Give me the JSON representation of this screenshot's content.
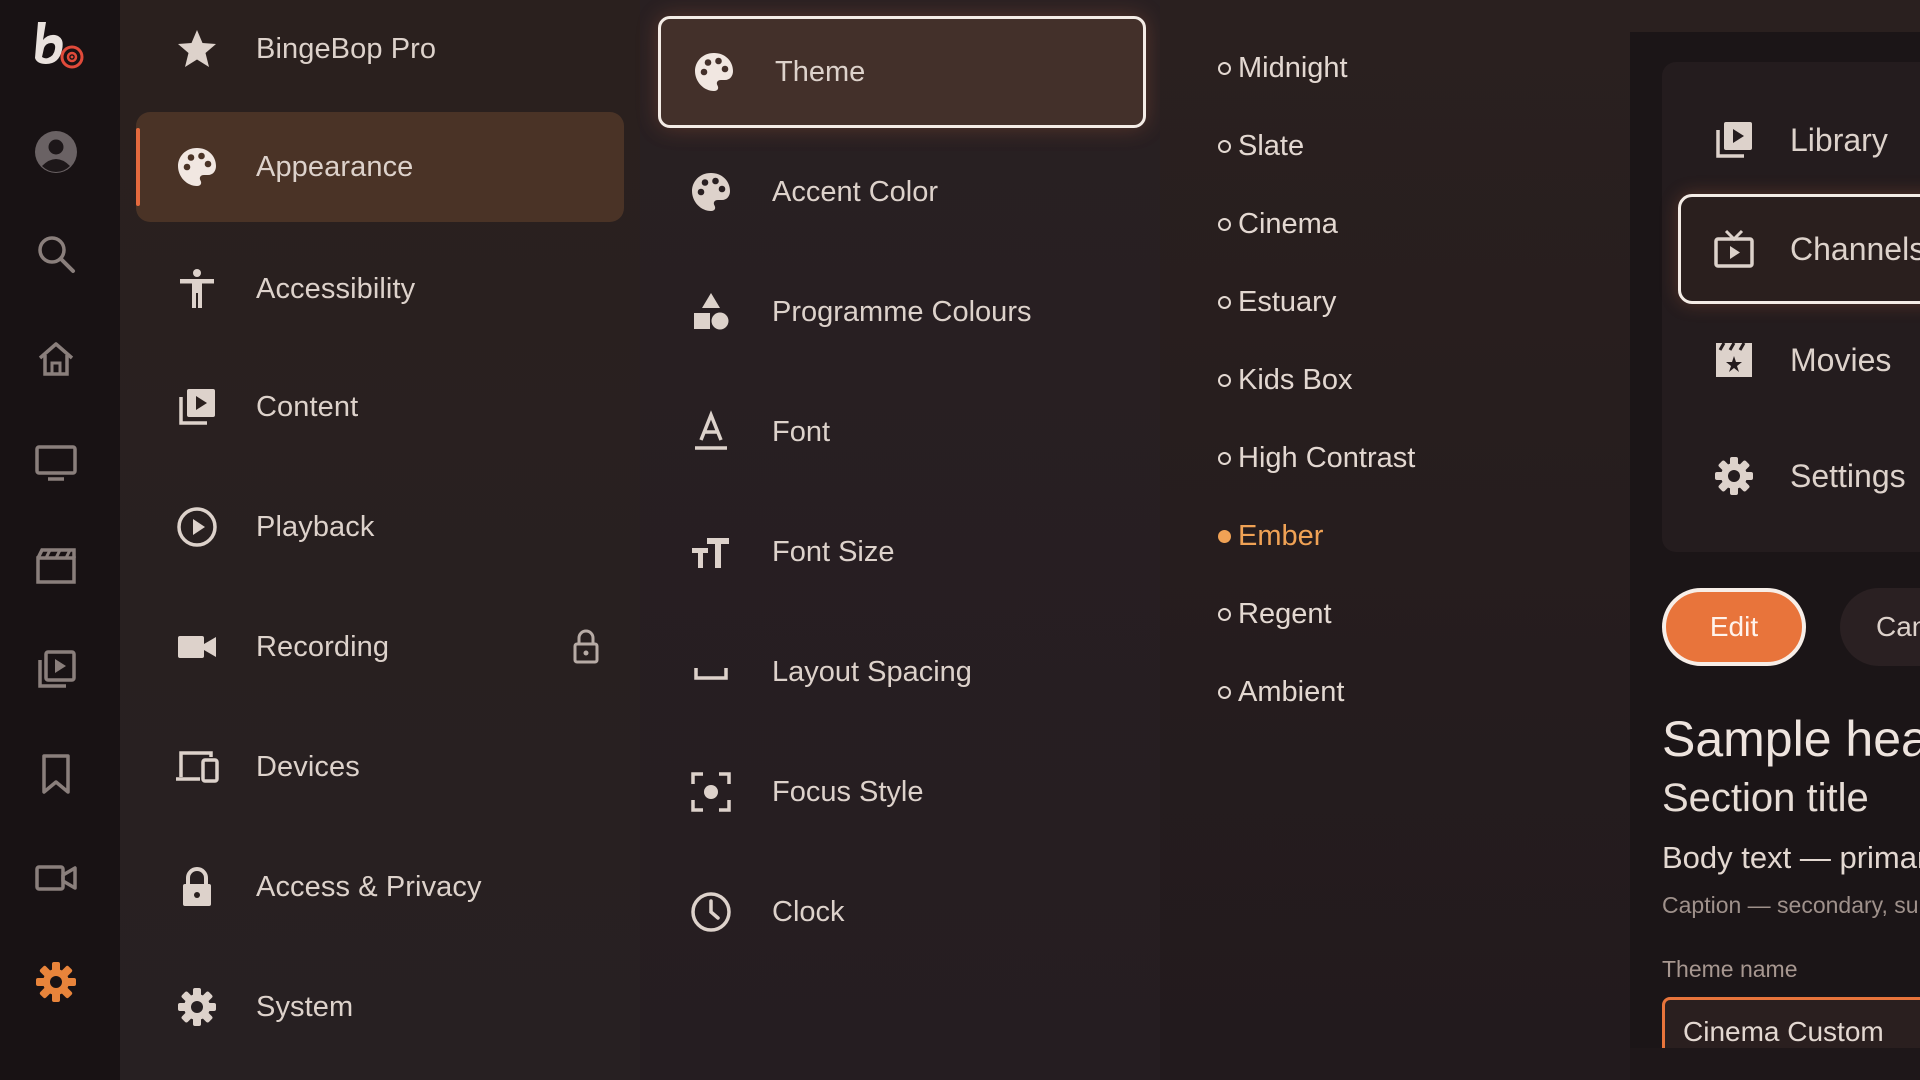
{
  "rail": {
    "items": [
      {
        "icon": "profile-icon"
      },
      {
        "icon": "search-icon"
      },
      {
        "icon": "home-icon"
      },
      {
        "icon": "tv-icon"
      },
      {
        "icon": "movies-icon"
      },
      {
        "icon": "library-icon"
      },
      {
        "icon": "bookmark-icon"
      },
      {
        "icon": "recordings-icon"
      },
      {
        "icon": "settings-icon",
        "active": true
      }
    ],
    "accent": "#e8843b"
  },
  "settings_menu": {
    "items": [
      {
        "label": "BingeBop Pro",
        "icon": "star-icon"
      },
      {
        "label": "Appearance",
        "icon": "palette-icon",
        "active": true
      },
      {
        "label": "Accessibility",
        "icon": "accessibility-icon"
      },
      {
        "label": "Content",
        "icon": "content-library-icon"
      },
      {
        "label": "Playback",
        "icon": "play-circle-icon"
      },
      {
        "label": "Recording",
        "icon": "camera-icon",
        "locked": true
      },
      {
        "label": "Devices",
        "icon": "devices-icon"
      },
      {
        "label": "Access & Privacy",
        "icon": "lock-icon"
      },
      {
        "label": "System",
        "icon": "gear-icon"
      }
    ]
  },
  "appearance_menu": {
    "items": [
      {
        "label": "Theme",
        "icon": "palette-icon",
        "focused": true
      },
      {
        "label": "Accent Color",
        "icon": "palette-icon"
      },
      {
        "label": "Programme Colours",
        "icon": "shapes-icon"
      },
      {
        "label": "Font",
        "icon": "font-icon"
      },
      {
        "label": "Font Size",
        "icon": "font-size-icon"
      },
      {
        "label": "Layout Spacing",
        "icon": "spacing-icon"
      },
      {
        "label": "Focus Style",
        "icon": "focus-icon"
      },
      {
        "label": "Clock",
        "icon": "clock-icon"
      }
    ]
  },
  "theme_options": {
    "items": [
      {
        "label": "Midnight"
      },
      {
        "label": "Slate"
      },
      {
        "label": "Cinema"
      },
      {
        "label": "Estuary"
      },
      {
        "label": "Kids Box"
      },
      {
        "label": "High Contrast"
      },
      {
        "label": "Ember",
        "selected": true
      },
      {
        "label": "Regent"
      },
      {
        "label": "Ambient"
      }
    ],
    "selected_color": "#f0a255"
  },
  "preview": {
    "nav": [
      {
        "label": "Library",
        "icon": "library-icon"
      },
      {
        "label": "Channels",
        "icon": "tv-play-icon",
        "focused": true
      },
      {
        "label": "Movies",
        "icon": "clapperboard-icon"
      },
      {
        "label": "Settings",
        "icon": "gear-icon"
      }
    ],
    "edit_label": "Edit",
    "cancel_label": "Cancel",
    "sample_heading": "Sample heading",
    "section_title": "Section title",
    "body_text": "Body text — primary",
    "caption": "Caption — secondary, subtle",
    "input_label": "Theme name",
    "input_value": "Cinema Custom",
    "accent": "#e8743b"
  }
}
